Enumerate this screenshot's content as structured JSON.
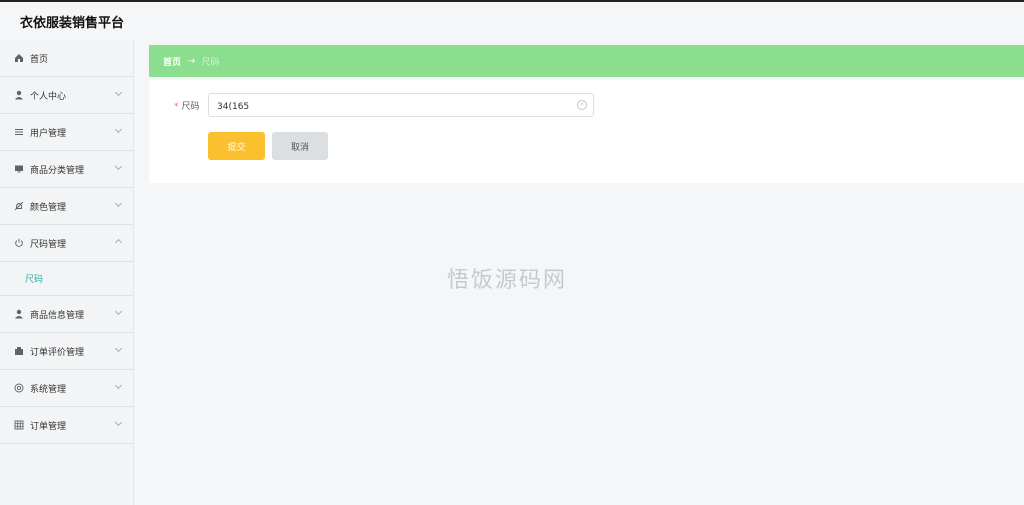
{
  "header": {
    "title": "衣依服装销售平台"
  },
  "sidebar": {
    "items": [
      {
        "label": "首页",
        "icon": "home-icon"
      },
      {
        "label": "个人中心",
        "icon": "user-icon"
      },
      {
        "label": "用户管理",
        "icon": "list-icon"
      },
      {
        "label": "商品分类管理",
        "icon": "monitor-icon"
      },
      {
        "label": "颜色管理",
        "icon": "bell-off-icon"
      },
      {
        "label": "尺码管理",
        "icon": "power-icon"
      },
      {
        "label": "商品信息管理",
        "icon": "user-icon"
      },
      {
        "label": "订单评价管理",
        "icon": "wallet-icon"
      },
      {
        "label": "系统管理",
        "icon": "aperture-icon"
      },
      {
        "label": "订单管理",
        "icon": "grid-icon"
      }
    ],
    "submenu": {
      "label": "尺码"
    }
  },
  "breadcrumb": {
    "home": "首页",
    "arrow": "→",
    "current": "尺码"
  },
  "form": {
    "required_mark": "*",
    "label": "尺码",
    "value": "34(165",
    "submit_label": "提交",
    "cancel_label": "取消"
  },
  "watermark": {
    "text": "悟饭源码网"
  },
  "colors": {
    "breadcrumb_bg": "#8ade8d",
    "submit": "#fbc02d",
    "cancel": "#dcdfe2",
    "active_submenu": "#2bb3a3"
  }
}
